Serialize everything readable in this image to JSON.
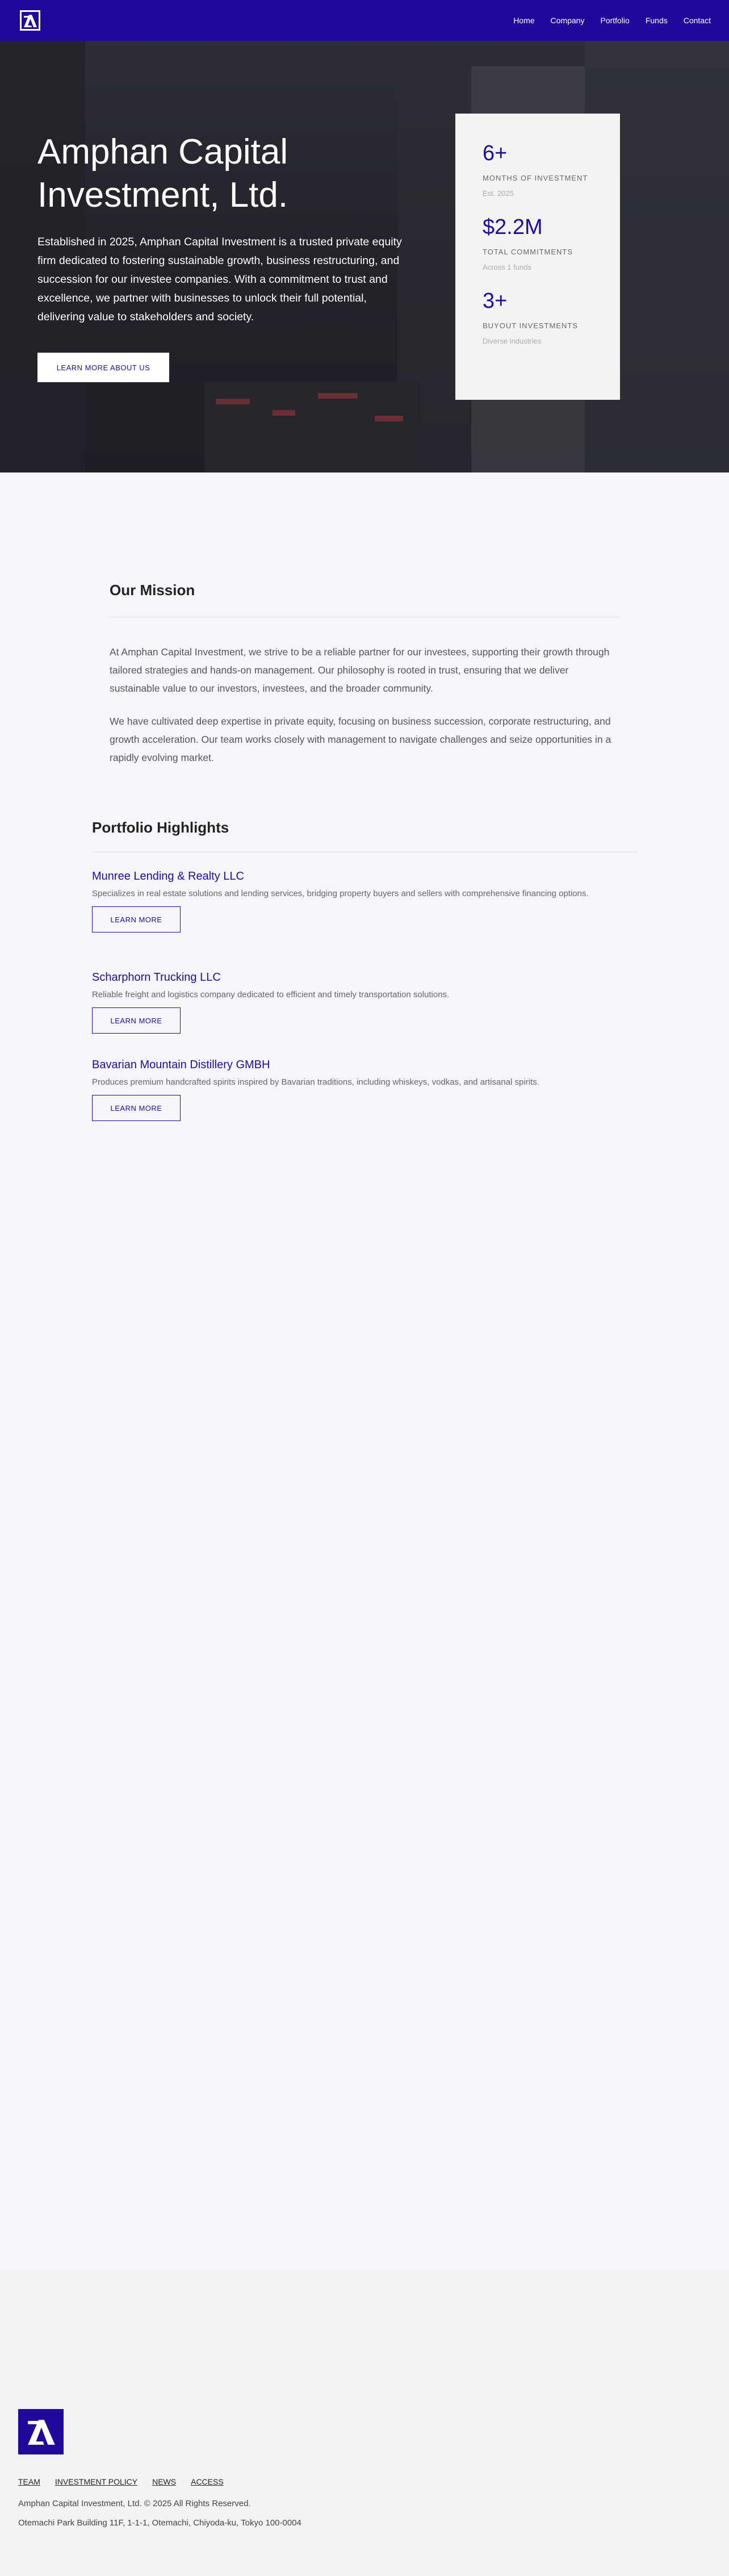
{
  "header": {
    "nav": [
      "Home",
      "Company",
      "Portfolio",
      "Funds",
      "Contact"
    ]
  },
  "hero": {
    "title": "Amphan Capital Investment, Ltd.",
    "description": "Established in 2025, Amphan Capital Investment is a trusted private equity firm dedicated to fostering sustainable growth, business restructuring, and succession for our investee companies. With a commitment to trust and excellence, we partner with businesses to unlock their full potential, delivering value to stakeholders and society.",
    "button": "LEARN MORE ABOUT US"
  },
  "stats": [
    {
      "value": "6+",
      "label": "MONTHS OF INVESTMENT",
      "sub": "Est. 2025"
    },
    {
      "value": "$2.2M",
      "label": "TOTAL COMMITMENTS",
      "sub": "Across 1 funds"
    },
    {
      "value": "3+",
      "label": "BUYOUT INVESTMENTS",
      "sub": "Diverse industries"
    }
  ],
  "mission": {
    "title": "Our Mission",
    "p1": "At Amphan Capital Investment, we strive to be a reliable partner for our investees, supporting their growth through tailored strategies and hands-on management. Our philosophy is rooted in trust, ensuring that we deliver sustainable value to our investors, investees, and the broader community.",
    "p2": "We have cultivated deep expertise in private equity, focusing on business succession, corporate restructuring, and growth acceleration. Our team works closely with management to navigate challenges and seize opportunities in a rapidly evolving market."
  },
  "portfolio": {
    "title": "Portfolio Highlights",
    "items": [
      {
        "name": "Munree Lending & Realty LLC",
        "desc": "Specializes in real estate solutions and lending services, bridging property buyers and sellers with comprehensive financing options.",
        "button": "LEARN MORE"
      },
      {
        "name": "Scharphorn Trucking LLC",
        "desc": "Reliable freight and logistics company dedicated to efficient and timely transportation solutions.",
        "button": "LEARN MORE"
      },
      {
        "name": "Bavarian Mountain Distillery GMBH",
        "desc": "Produces premium handcrafted spirits inspired by Bavarian traditions, including whiskeys, vodkas, and artisanal spirits.",
        "button": "LEARN MORE"
      }
    ]
  },
  "footer": {
    "links": [
      "TEAM",
      "INVESTMENT POLICY",
      "NEWS",
      "ACCESS"
    ],
    "copyright": "Amphan Capital Investment, Ltd. © 2025 All Rights Reserved.",
    "address": "Otemachi Park Building 11F, 1-1-1, Otemachi, Chiyoda-ku, Tokyo 100-0004"
  },
  "colors": {
    "brand": "#200a9c",
    "hero_overlay": "#2c2d33"
  },
  "icons": {
    "logo": "amphan-logo-icon"
  }
}
